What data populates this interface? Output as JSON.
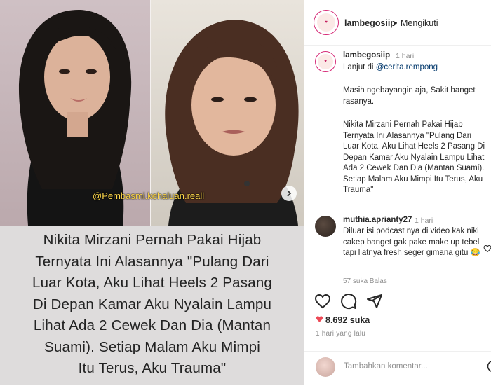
{
  "media": {
    "watermark": "@Pembasmi.kehaluan.reall",
    "caption_lines": [
      "Nikita Mirzani Pernah Pakai Hijab",
      "Ternyata Ini Alasannya \"Pulang Dari",
      "Luar Kota, Aku Lihat Heels 2 Pasang",
      "Di Depan Kamar Aku Nyalain Lampu",
      " Lihat Ada 2 Cewek Dan Dia (Mantan",
      "Suami). Setiap Malam Aku Mimpi",
      "Itu Terus, Aku Trauma\""
    ]
  },
  "header": {
    "username": "lambegosiip",
    "separator": "•",
    "follow_status": "Mengikuti"
  },
  "caption": {
    "username": "lambegosiip",
    "time": "1 hari",
    "line1_prefix": "Lanjut di ",
    "line1_mention": "@cerita.rempong",
    "para2": "Masih ngebayangin aja, Sakit banget rasanya.",
    "para3": "Nikita Mirzani Pernah Pakai Hijab Ternyata Ini Alasannya \"Pulang Dari Luar Kota, Aku Lihat Heels 2 Pasang Di Depan Kamar Aku Nyalain Lampu Lihat Ada 2 Cewek Dan Dia (Mantan Suami). Setiap Malam Aku Mimpi Itu Terus, Aku Trauma\""
  },
  "comment": {
    "username": "muthia.aprianty27",
    "time": "1 hari",
    "text": "Diluar isi podcast nya di video kak niki cakep banget gak pake make up tebel tapi liatnya fresh seger gimana gitu 😂",
    "meta": "57 suka   Balas"
  },
  "actions": {
    "likes": "8.692 suka",
    "post_time": "1 hari yang lalu",
    "comment_placeholder": "Tambahkan komentar..."
  },
  "icons": [
    "chevron-right-icon",
    "heart-icon",
    "comment-icon",
    "share-icon",
    "likes-heart-icon",
    "emoji-icon"
  ],
  "colors": {
    "mention": "#00376b",
    "watermark": "#ffd84a",
    "caption_bg": "#dedcdc"
  }
}
